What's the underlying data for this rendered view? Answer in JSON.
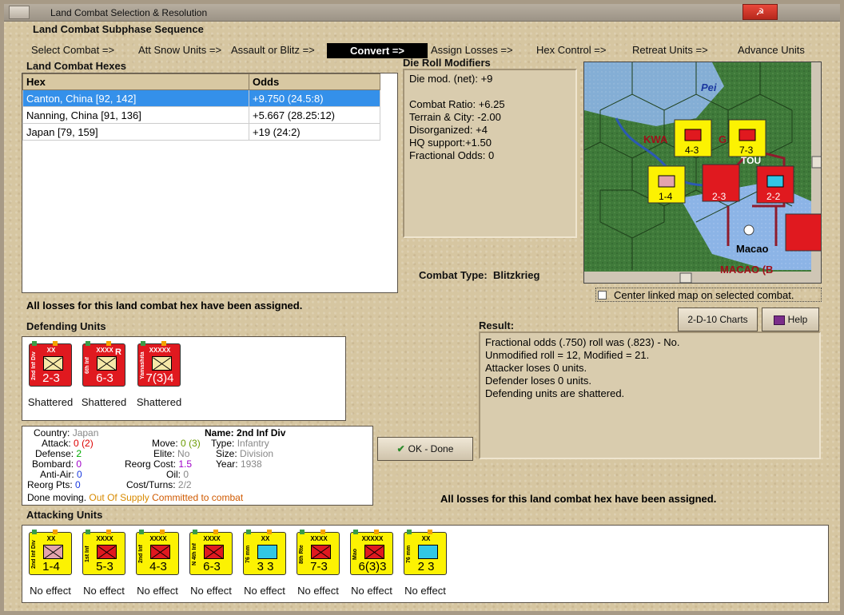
{
  "window": {
    "title": "Land Combat Selection & Resolution"
  },
  "subphase": {
    "title": "Land Combat Subphase Sequence",
    "steps": [
      "Select Combat =>",
      "Att Snow Units =>",
      "Assault or Blitz =>",
      "Convert =>",
      "Assign Losses =>",
      "Hex Control =>",
      "Retreat Units =>",
      "Advance Units"
    ],
    "active_index": 3
  },
  "hexes": {
    "title": "Land Combat Hexes",
    "columns": [
      "Hex",
      "Odds"
    ],
    "rows": [
      {
        "hex": "Canton, China [92, 142]",
        "odds": "+9.750 (24.5:8)"
      },
      {
        "hex": "Nanning, China [91, 136]",
        "odds": "+5.667 (28.25:12)"
      },
      {
        "hex": "Japan [79, 159]",
        "odds": "+19 (24:2)"
      }
    ]
  },
  "modifiers": {
    "title": "Die Roll Modifiers",
    "lines": [
      "Die mod. (net): +9",
      "",
      "Combat Ratio: +6.25",
      "Terrain & City: -2.00",
      "Disorganized: +4",
      "HQ support:+1.50",
      "Fractional Odds: 0"
    ]
  },
  "combat_type": {
    "label": "Combat Type:",
    "value": "Blitzkrieg"
  },
  "map": {
    "center_label": "Center linked map on selected combat.",
    "labels": {
      "pei": "Pei",
      "kwa": "KWA",
      "g": "G",
      "macao": "Macao",
      "macao_b": "MACAO (B",
      "to": "TOU"
    }
  },
  "losses_assigned": "All losses for this land combat hex have been assigned.",
  "defending": {
    "title": "Defending Units",
    "units": [
      {
        "name": "2nd Inf Div",
        "size": "XX",
        "values": "2-3",
        "status": "Shattered",
        "r": ""
      },
      {
        "name": "6th Inf",
        "size": "XXXX",
        "values": "6-3",
        "status": "Shattered",
        "r": "R"
      },
      {
        "name": "Yamashita",
        "size": "XXXXX",
        "values": "7(3)4",
        "status": "Shattered",
        "r": ""
      }
    ]
  },
  "charts_button": "2-D-10 Charts",
  "help_button": "Help",
  "result": {
    "title": "Result:",
    "lines": [
      "Fractional odds (.750) roll was (.823)  - No.",
      "Unmodified roll = 12, Modified = 21.",
      "Attacker loses 0 units.",
      "Defender loses 0 units.",
      "Defending units are shattered."
    ]
  },
  "unit_info": {
    "country_label": "Country:",
    "country": "Japan",
    "name_label": "Name:",
    "name": "2nd Inf Div",
    "attack_label": "Attack:",
    "attack": "0",
    "attack_mod": "(2)",
    "move_label": "Move:",
    "move": "0",
    "move_mod": "(3)",
    "type_label": "Type:",
    "type": "Infantry",
    "defense_label": "Defense:",
    "defense": "2",
    "elite_label": "Elite:",
    "elite": "No",
    "size_label": "Size:",
    "size": "Division",
    "bombard_label": "Bombard:",
    "bombard": "0",
    "reorg_cost_label": "Reorg Cost:",
    "reorg_cost": "1.5",
    "year_label": "Year:",
    "year": "1938",
    "anti_air_label": "Anti-Air:",
    "anti_air": "0",
    "oil_label": "Oil:",
    "oil": "0",
    "reorg_pts_label": "Reorg Pts:",
    "reorg_pts": "0",
    "cost_turns_label": "Cost/Turns:",
    "cost_turns": "2/2",
    "done": "Done moving.",
    "supply": "Out Of Supply",
    "committed": "Committed to combat"
  },
  "ok_button": "OK - Done",
  "attacking": {
    "title": "Attacking Units",
    "units": [
      {
        "name": "2nd Inf Div",
        "size": "XX",
        "values": "1-4",
        "status": "No effect"
      },
      {
        "name": "1st Inf",
        "size": "XXXX",
        "values": "5-3",
        "status": "No effect"
      },
      {
        "name": "2nd Inf",
        "size": "XXXX",
        "values": "4-3",
        "status": "No effect"
      },
      {
        "name": "N 4th Inf",
        "size": "XXXX",
        "values": "6-3",
        "status": "No effect"
      },
      {
        "name": "76 mm",
        "size": "XX",
        "values": "3 3",
        "status": "No effect"
      },
      {
        "name": "8th Rte",
        "size": "XXXX",
        "values": "7-3",
        "status": "No effect"
      },
      {
        "name": "Mao",
        "size": "XXXXX",
        "values": "6(3)3",
        "status": "No effect"
      },
      {
        "name": "76 mm",
        "size": "XX",
        "values": "2 3",
        "status": "No effect"
      }
    ]
  },
  "colors": {
    "accent_blue": "#3490ea",
    "unit_red": "#e0191f",
    "unit_yellow": "#fcf202",
    "modifier_purple": "#a000c8"
  }
}
